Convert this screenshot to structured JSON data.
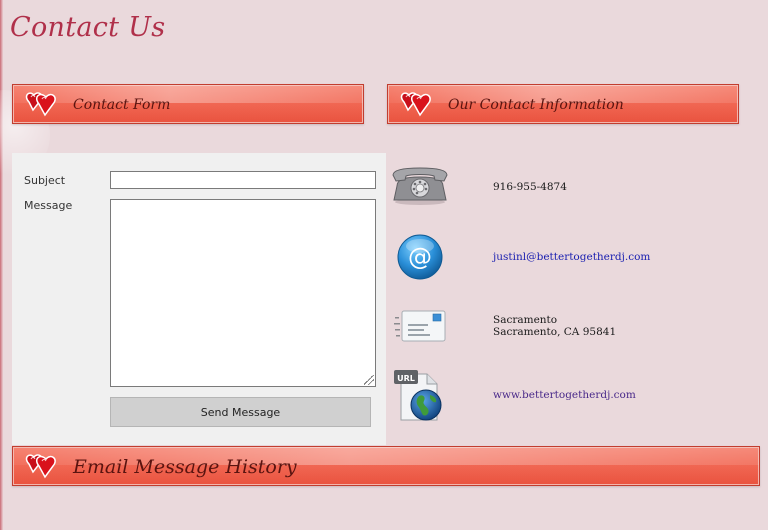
{
  "page": {
    "title": "Contact Us"
  },
  "banners": {
    "contact_form": "Contact Form",
    "contact_info": "Our Contact Information",
    "email_history": "Email Message History"
  },
  "form": {
    "subject_label": "Subject",
    "subject_value": "",
    "message_label": "Message",
    "message_value": "",
    "send_label": "Send Message"
  },
  "contact_info": {
    "phone": "916-955-4874",
    "email": "justinl@bettertogetherdj.com",
    "address_line1": "Sacramento",
    "address_line2": "Sacramento, CA 95841",
    "website": "www.bettertogetherdj.com"
  },
  "icons": {
    "hearts": "hearts-icon",
    "phone": "telephone-icon",
    "email": "at-sign-icon",
    "address": "letter-icon",
    "website": "url-globe-icon"
  },
  "colors": {
    "page_bg": "#ead9dc",
    "banner": "#ef634f",
    "title": "#b0304a",
    "link": "#1a1fb0"
  }
}
